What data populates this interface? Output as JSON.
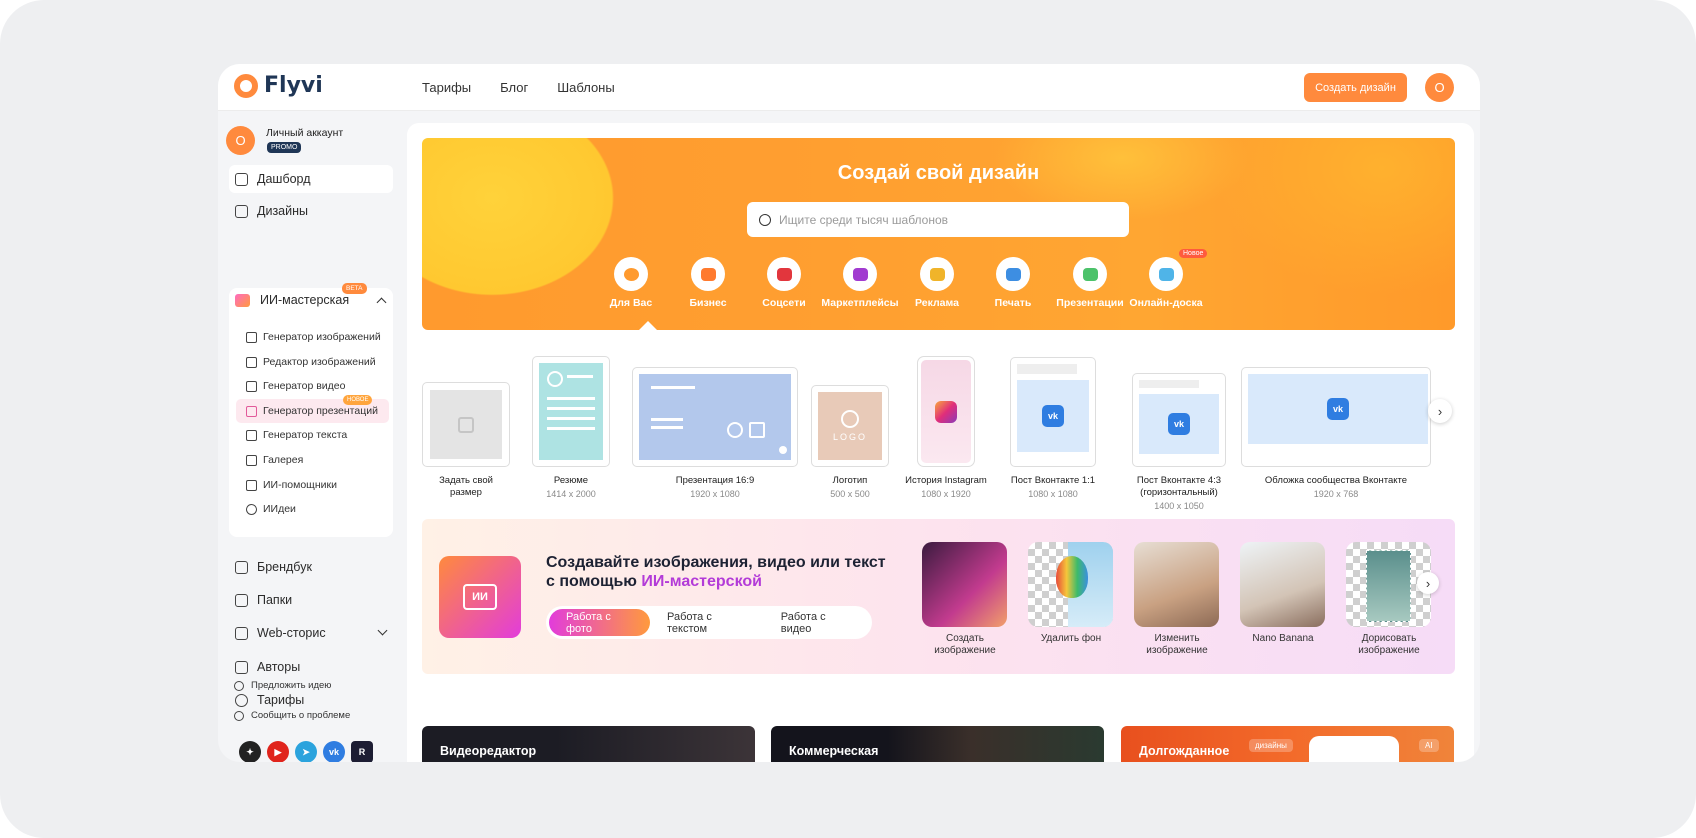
{
  "header": {
    "logo_text": "Flyvi",
    "nav": [
      "Тарифы",
      "Блог",
      "Шаблоны"
    ],
    "create_button": "Создать дизайн",
    "avatar_letter": "О"
  },
  "sidebar": {
    "account": {
      "avatar_letter": "О",
      "name": "Личный аккаунт",
      "badge": "PROMO"
    },
    "items_top": [
      "Дашборд",
      "Дизайны"
    ],
    "ai": {
      "title": "ИИ-мастерская",
      "badge": "BETA",
      "subitems": [
        "Генератор изображений",
        "Редактор изображений",
        "Генератор видео",
        "Генератор презентаций",
        "Генератор текста",
        "Галерея",
        "ИИ-помощники",
        "ИИдеи"
      ],
      "new_badge": "НОВОЕ"
    },
    "items_bottom": [
      "Брендбук",
      "Папки",
      "Web-сторис",
      "Авторы",
      "Тарифы"
    ],
    "links": [
      "Предложить идею",
      "Сообщить о проблеме"
    ],
    "socials": [
      "dzen-icon",
      "youtube-icon",
      "telegram-icon",
      "vk-icon",
      "rutube-icon"
    ]
  },
  "hero": {
    "title": "Создай свой дизайн",
    "search_placeholder": "Ищите среди тысяч шаблонов",
    "categories": [
      "Для Вас",
      "Бизнес",
      "Соцсети",
      "Маркетплейсы",
      "Реклама",
      "Печать",
      "Презентации",
      "Онлайн-доска"
    ],
    "new_badge": "Новое"
  },
  "templates": [
    {
      "name": "Задать свой размер",
      "size": ""
    },
    {
      "name": "Резюме",
      "size": "1414 x 2000"
    },
    {
      "name": "Презентация 16:9",
      "size": "1920 x 1080"
    },
    {
      "name": "Логотип",
      "size": "500 x 500"
    },
    {
      "name": "История Instagram",
      "size": "1080 x 1920"
    },
    {
      "name": "Пост Вконтакте 1:1",
      "size": "1080 x 1080"
    },
    {
      "name": "Пост Вконтакте 4:3 (горизонтальный)",
      "size": "1400 x 1050"
    },
    {
      "name": "Обложка сообщества Вконтакте",
      "size": "1920 x 768"
    }
  ],
  "logo_card_text": "LOGO",
  "ai_promo": {
    "heading_line1": "Создавайте изображения, видео или текст",
    "heading_line2_prefix": "с помощью ",
    "heading_line2_accent": "ИИ-мастерской",
    "chip_text": "ИИ",
    "tabs": [
      "Работа с фото",
      "Работа с текстом",
      "Работа с видео"
    ],
    "thumbs": [
      "Создать изображение",
      "Удалить фон",
      "Изменить изображение",
      "Nano Banana",
      "Дорисовать изображение"
    ]
  },
  "banners": [
    "Видеоредактор",
    "Коммерческая",
    "Долгожданное"
  ],
  "banner_tags": {
    "designs": "дизайны",
    "ai": "AI"
  },
  "colors": {
    "accent": "#ff8a3d",
    "brand_dark": "#1f3656",
    "ai_accent": "#b33bd8"
  }
}
